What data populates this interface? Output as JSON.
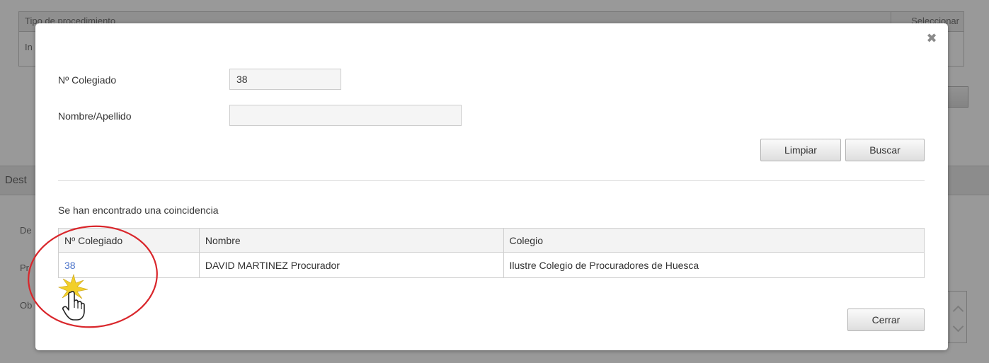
{
  "background": {
    "table": {
      "col_type": "Tipo de procedimiento",
      "col_select": "Seleccionar",
      "row_prefix": "In"
    },
    "section_title": "Dest",
    "labels": [
      "De",
      "Pr",
      "Ob"
    ]
  },
  "modal": {
    "close_glyph": "✖",
    "form": {
      "colegiado_label": "Nº Colegiado",
      "colegiado_value": "38",
      "nombre_label": "Nombre/Apellido",
      "nombre_value": ""
    },
    "buttons": {
      "clear": "Limpiar",
      "search": "Buscar",
      "close": "Cerrar"
    },
    "results": {
      "message": "Se han encontrado una coincidencia",
      "columns": [
        "Nº Colegiado",
        "Nombre",
        "Colegio"
      ],
      "rows": [
        [
          "38",
          "DAVID MARTINEZ Procurador",
          "Ilustre Colegio de Procuradores de Huesca"
        ]
      ]
    }
  },
  "annotation": {
    "circle_color": "#d9262b",
    "sparkle_color": "#f2cf2a",
    "cursor_icon": "hand-pointer-icon"
  }
}
